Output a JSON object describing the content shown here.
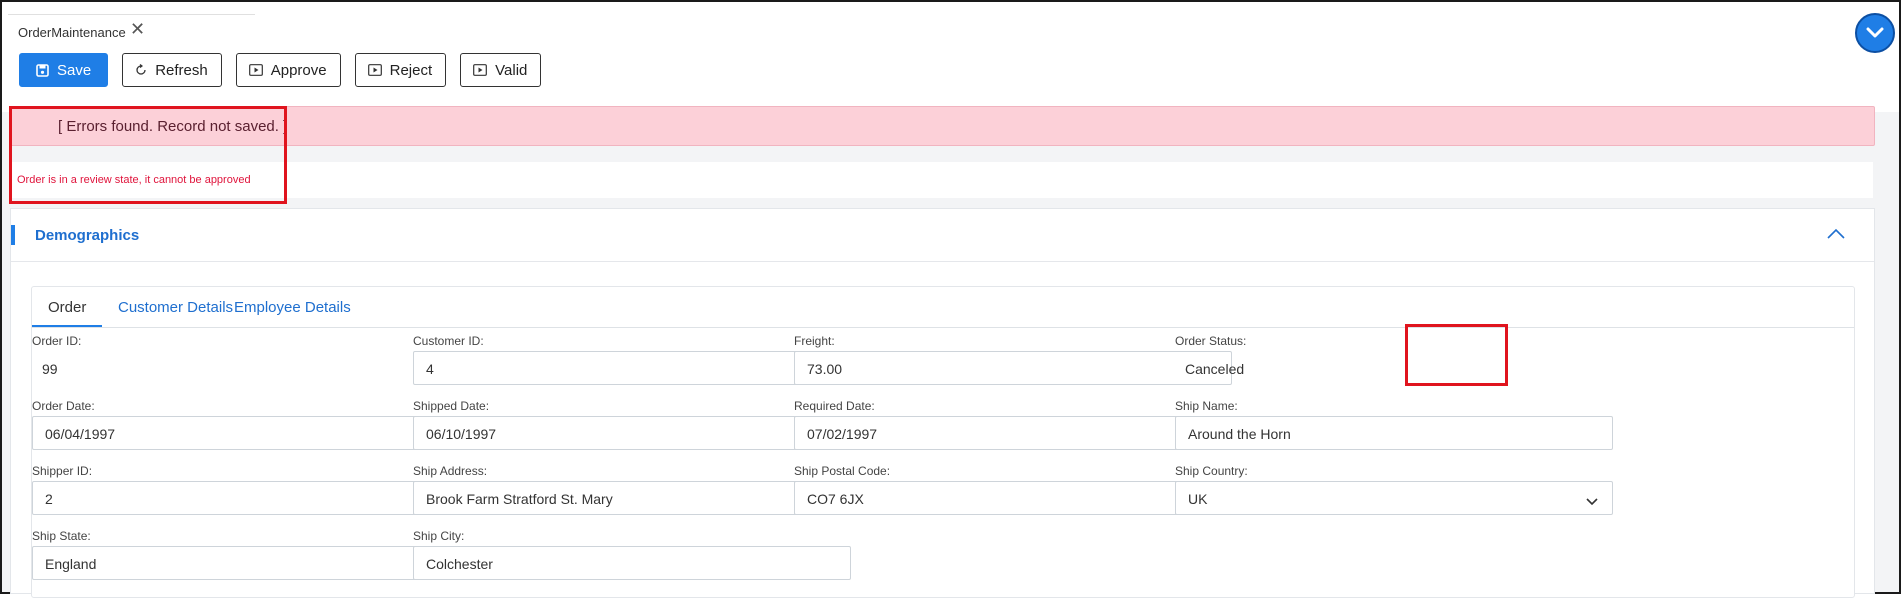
{
  "window": {
    "tab_title": "OrderMaintenance"
  },
  "toolbar": {
    "save": "Save",
    "refresh": "Refresh",
    "approve": "Approve",
    "reject": "Reject",
    "valid": "Valid"
  },
  "errors": {
    "banner": "[ Errors found. Record not saved. ]",
    "message": "Order is in a review state, it cannot be approved"
  },
  "section": {
    "title": "Demographics",
    "tabs": [
      "Order",
      "Customer Details",
      "Employee Details"
    ],
    "active_tab": "Order"
  },
  "fields": {
    "order_id": {
      "label": "Order ID:",
      "value": "99"
    },
    "customer_id": {
      "label": "Customer ID:",
      "value": "4"
    },
    "freight": {
      "label": "Freight:",
      "value": "73.00"
    },
    "order_status": {
      "label": "Order Status:",
      "value": "Canceled"
    },
    "order_date": {
      "label": "Order Date:",
      "value": "06/04/1997"
    },
    "shipped_date": {
      "label": "Shipped Date:",
      "value": "06/10/1997"
    },
    "required_date": {
      "label": "Required Date:",
      "value": "07/02/1997"
    },
    "ship_name": {
      "label": "Ship Name:",
      "value": "Around the Horn"
    },
    "shipper_id": {
      "label": "Shipper ID:",
      "value": "2"
    },
    "ship_address": {
      "label": "Ship Address:",
      "value": "Brook Farm Stratford St. Mary"
    },
    "ship_postal_code": {
      "label": "Ship Postal Code:",
      "value": "CO7 6JX"
    },
    "ship_country": {
      "label": "Ship Country:",
      "value": "UK"
    },
    "ship_state": {
      "label": "Ship State:",
      "value": "England"
    },
    "ship_city": {
      "label": "Ship City:",
      "value": "Colchester"
    }
  },
  "colors": {
    "primary": "#1f7ee6",
    "error_bg": "#fcd0d8",
    "error_text": "#e0143c",
    "highlight": "#e0141e"
  },
  "icons": {
    "tab_close": "close-icon",
    "collapse": "chevron-down-icon",
    "save": "save-icon",
    "refresh": "refresh-icon",
    "approve": "play-icon",
    "reject": "play-icon",
    "valid": "play-icon",
    "section_toggle": "chevron-up-icon",
    "date": "calendar-icon",
    "select": "chevron-down-icon"
  }
}
